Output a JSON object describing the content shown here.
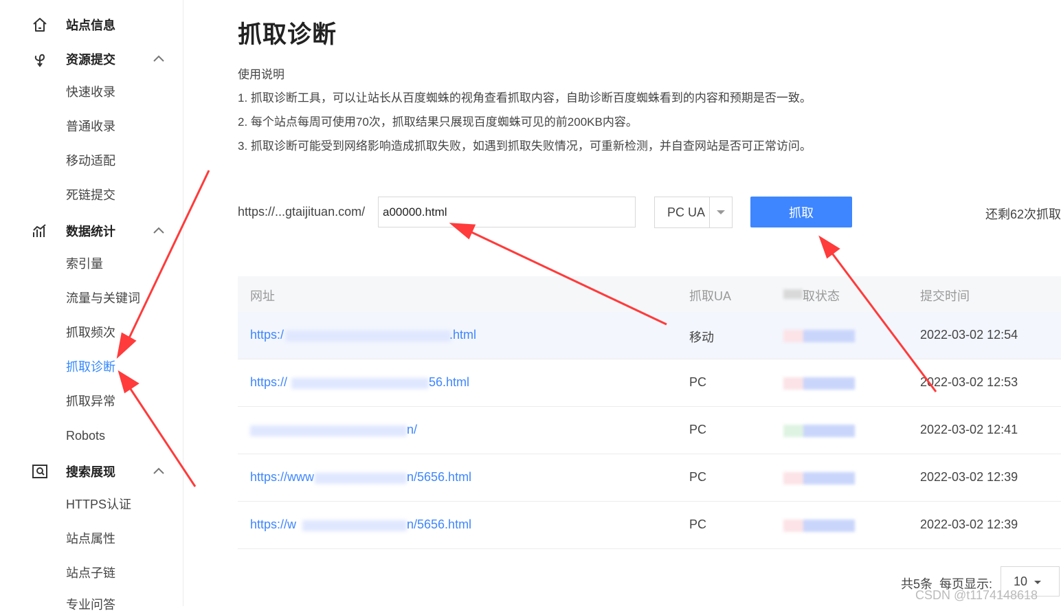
{
  "sidebar": {
    "groups": [
      {
        "label": "站点信息",
        "icon": "home-icon",
        "items": []
      },
      {
        "label": "资源提交",
        "icon": "submit-icon",
        "items": [
          "快速收录",
          "普通收录",
          "移动适配",
          "死链提交"
        ]
      },
      {
        "label": "数据统计",
        "icon": "stats-icon",
        "items": [
          "索引量",
          "流量与关键词",
          "抓取频次",
          "抓取诊断",
          "抓取异常",
          "Robots"
        ]
      },
      {
        "label": "搜索展现",
        "icon": "search-display-icon",
        "items": [
          "HTTPS认证",
          "站点属性",
          "站点子链",
          "专业问答"
        ]
      }
    ],
    "active_item": "抓取诊断"
  },
  "main": {
    "title": "抓取诊断",
    "usage_title": "使用说明",
    "usage_lines": [
      "1. 抓取诊断工具，可以让站长从百度蜘蛛的视角查看抓取内容，自助诊断百度蜘蛛看到的内容和预期是否一致。",
      "2. 每个站点每周可使用70次，抓取结果只展现百度蜘蛛可见的前200KB内容。",
      "3. 抓取诊断可能受到网络影响造成抓取失败，如遇到抓取失败情况，可重新检测，并自查网站是否可正常访问。"
    ],
    "url_prefix": "https://...gtaijituan.com/",
    "path_value": "a00000.html",
    "ua_selected": "PC UA",
    "fetch_button": "抓取",
    "remaining": "还剩62次抓取"
  },
  "table": {
    "headers": [
      "网址",
      "抓取UA",
      "抓取状态",
      "提交时间"
    ],
    "header_visible": [
      "网址",
      "抓取UA",
      "取状态",
      "提交时间"
    ],
    "rows": [
      {
        "url_start": "https:/",
        "url_end": ".html",
        "ua": "移动",
        "time": "2022-03-02 12:54"
      },
      {
        "url_start": "https://",
        "url_end": "56.html",
        "ua": "PC",
        "time": "2022-03-02 12:53"
      },
      {
        "url_start": "",
        "url_end": "n/",
        "ua": "PC",
        "time": "2022-03-02 12:41"
      },
      {
        "url_start": "https://www",
        "url_end": "n/5656.html",
        "ua": "PC",
        "time": "2022-03-02 12:39"
      },
      {
        "url_start": "https://w",
        "url_end": "n/5656.html",
        "ua": "PC",
        "time": "2022-03-02 12:39"
      }
    ]
  },
  "pagination": {
    "total": "共5条",
    "per_page_label": "每页显示:",
    "per_page_value": "10"
  },
  "watermark": "CSDN @t1174148618",
  "colors": {
    "accent": "#3e86ff",
    "annotation": "#ff3b3b",
    "active_nav": "#3388ff"
  }
}
